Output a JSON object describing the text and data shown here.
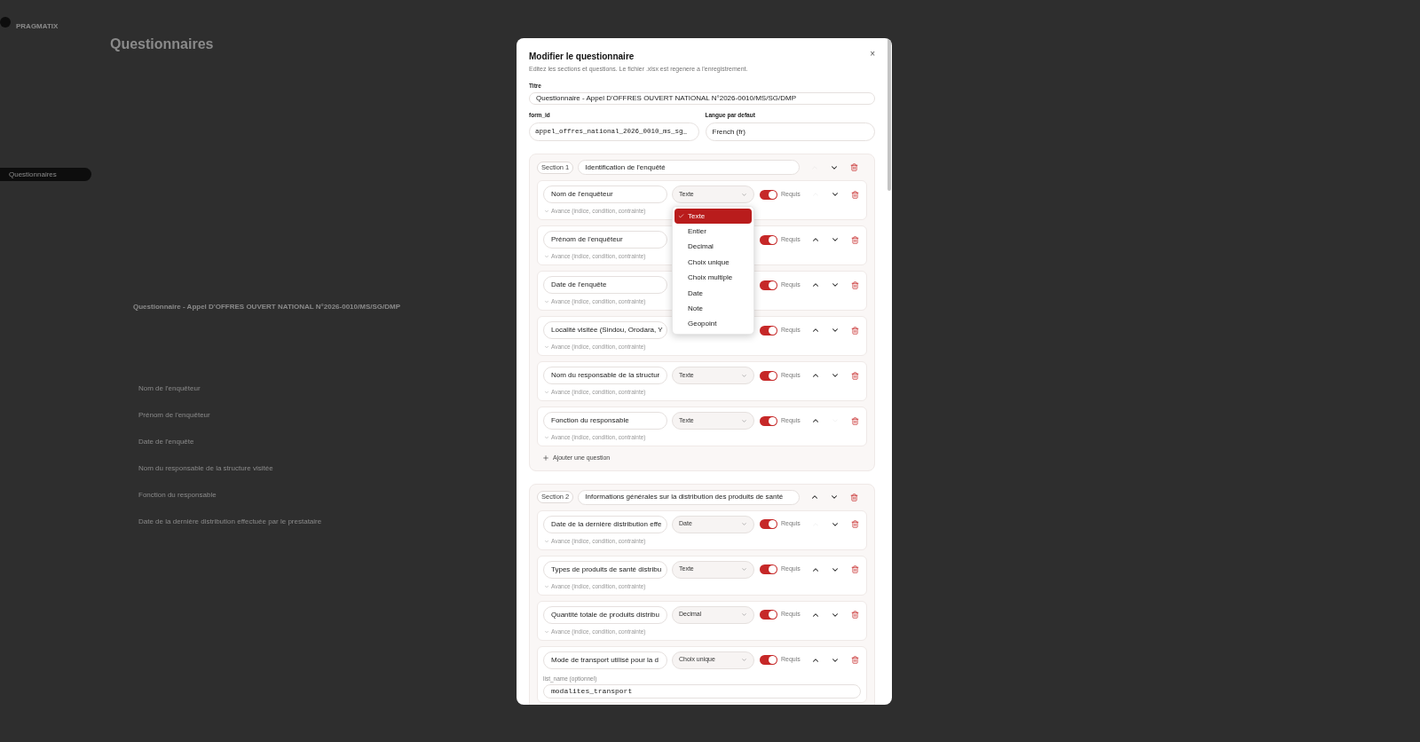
{
  "background": {
    "brand": "PRAGMATIX",
    "nav_active": "Questionnaires",
    "page_title": "Questionnaires",
    "questionnaire_title": "Questionnaire - Appel D'OFFRES OUVERT NATIONAL N°2026-0010/MS/SG/DMP",
    "questions": [
      "Nom de l'enquêteur",
      "Prénom de l'enquêteur",
      "Date de l'enquête",
      "Nom du responsable de la structure visitée",
      "Fonction du responsable",
      "Date de la dernière distribution effectuée par le prestataire"
    ]
  },
  "modal": {
    "title": "Modifier le questionnaire",
    "subtitle": "Editez les sections et questions. Le fichier .xlsx est regenere a l'enregistrement.",
    "close": "×",
    "title_field": {
      "label": "Titre",
      "value": "Questionnaire - Appel D'OFFRES OUVERT NATIONAL N°2026-0010/MS/SG/DMP"
    },
    "form_id_field": {
      "label": "form_id",
      "value": "appel_offres_national_2026_0010_ms_sg_"
    },
    "language_field": {
      "label": "Langue par defaut",
      "value": "French (fr)"
    },
    "sections": [
      {
        "badge": "Section 1",
        "title": "Identification de l'enquêté",
        "up_disabled": true,
        "down_disabled": false,
        "add_label": "Ajouter une question",
        "questions": [
          {
            "label": "Nom de l'enquêteur",
            "type": "Texte",
            "required": true,
            "required_label": "Requis",
            "advanced": "Avance (indice, condition, contrainte)",
            "up_disabled": true,
            "down_disabled": false,
            "menu": [
              {
                "label": "Texte",
                "selected": true
              },
              {
                "label": "Entier",
                "selected": false
              },
              {
                "label": "Decimal",
                "selected": false
              },
              {
                "label": "Choix unique",
                "selected": false
              },
              {
                "label": "Choix multiple",
                "selected": false
              },
              {
                "label": "Date",
                "selected": false
              },
              {
                "label": "Note",
                "selected": false
              },
              {
                "label": "Geopoint",
                "selected": false
              }
            ]
          },
          {
            "label": "Prénom de l'enquêteur",
            "required": true,
            "required_label": "Requis",
            "advanced": "Avance (indice, condition, contrainte)",
            "up_disabled": false,
            "down_disabled": false
          },
          {
            "label": "Date de l'enquête",
            "required": true,
            "required_label": "Requis",
            "advanced": "Avance (indice, condition, contrainte)",
            "up_disabled": false,
            "down_disabled": false
          },
          {
            "label": "Localité visitée (Sindou, Orodara, Y",
            "required": true,
            "required_label": "Requis",
            "advanced": "Avance (indice, condition, contrainte)",
            "up_disabled": false,
            "down_disabled": false
          },
          {
            "label": "Nom du responsable de la structur",
            "type": "Texte",
            "required": true,
            "required_label": "Requis",
            "advanced": "Avance (indice, condition, contrainte)",
            "up_disabled": false,
            "down_disabled": false
          },
          {
            "label": "Fonction du responsable",
            "type": "Texte",
            "required": true,
            "required_label": "Requis",
            "advanced": "Avance (indice, condition, contrainte)",
            "up_disabled": false,
            "down_disabled": true
          }
        ]
      },
      {
        "badge": "Section 2",
        "title": "Informations générales sur la distribution des produits de santé",
        "up_disabled": false,
        "down_disabled": false,
        "questions": [
          {
            "label": "Date de la dernière distribution effe",
            "type": "Date",
            "required": true,
            "required_label": "Requis",
            "advanced": "Avance (indice, condition, contrainte)",
            "up_disabled": true,
            "down_disabled": false
          },
          {
            "label": "Types de produits de santé distribu",
            "type": "Texte",
            "required": true,
            "required_label": "Requis",
            "advanced": "Avance (indice, condition, contrainte)",
            "up_disabled": false,
            "down_disabled": false
          },
          {
            "label": "Quantité totale de produits distribu",
            "type": "Decimal",
            "required": true,
            "required_label": "Requis",
            "advanced": "Avance (indice, condition, contrainte)",
            "up_disabled": false,
            "down_disabled": false
          },
          {
            "label": "Mode de transport utilisé pour la d",
            "type": "Choix unique",
            "required": true,
            "required_label": "Requis",
            "up_disabled": false,
            "down_disabled": false,
            "list_name": {
              "label": "list_name (optionnel)",
              "value": "modalites_transport"
            }
          }
        ]
      }
    ]
  }
}
